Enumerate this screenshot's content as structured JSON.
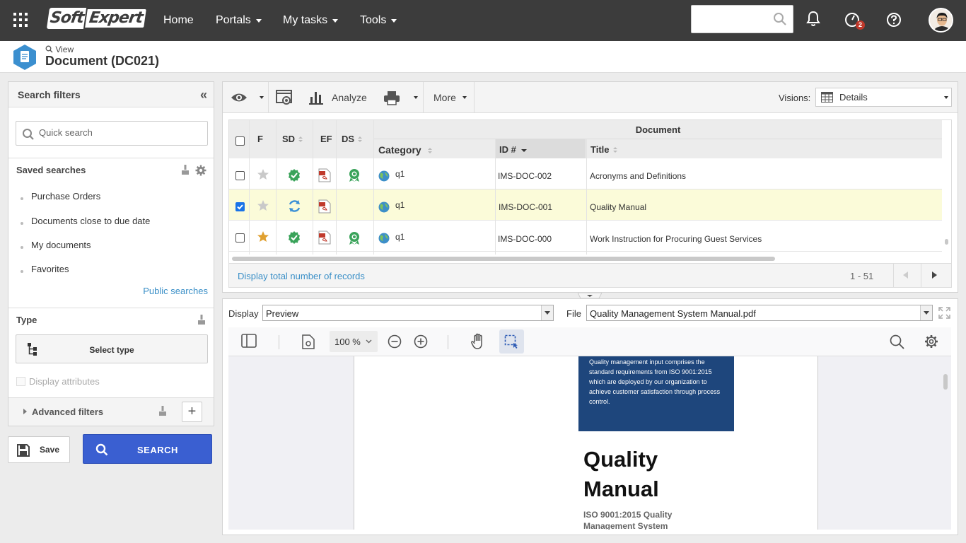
{
  "header": {
    "logo_left": "Soft",
    "logo_right": "Expert",
    "nav": [
      "Home",
      "Portals",
      "My tasks",
      "Tools"
    ],
    "notification_count": "2"
  },
  "titlebar": {
    "view_label": "View",
    "title": "Document (DC021)"
  },
  "left_panel": {
    "title": "Search filters",
    "collapse_glyph": "«",
    "quick_search_placeholder": "Quick search",
    "saved_searches_title": "Saved searches",
    "saved_searches": [
      "Purchase Orders",
      "Documents close to due date",
      "My documents",
      "Favorites"
    ],
    "public_searches": "Public searches",
    "type_title": "Type",
    "select_type": "Select type",
    "display_attributes": "Display attributes",
    "advanced_filters": "Advanced filters",
    "plus": "+",
    "save_label": "Save",
    "search_label": "SEARCH"
  },
  "toolbar": {
    "analyze": "Analyze",
    "more": "More",
    "visions_label": "Visions:",
    "visions_value": "Details"
  },
  "grid": {
    "columns": {
      "f": "F",
      "sd": "SD",
      "ef": "EF",
      "ds": "DS",
      "group": "Document",
      "category": "Category",
      "id": "ID #",
      "title": "Title"
    },
    "rows": [
      {
        "category": "q1",
        "id": "IMS-DOC-002",
        "title": "Acronyms and Definitions"
      },
      {
        "category": "q1",
        "id": "IMS-DOC-001",
        "title": "Quality Manual"
      },
      {
        "category": "q1",
        "id": "IMS-DOC-000",
        "title": "Work Instruction for Procuring Guest Services"
      }
    ],
    "footer_link": "Display total number of records",
    "pagination": "1 - 51"
  },
  "preview": {
    "display_label": "Display",
    "display_value": "Preview",
    "file_label": "File",
    "file_value": "Quality Management System Manual.pdf",
    "zoom": "100 %",
    "pdf_block_text": "Quality management input comprises the standard requirements from ISO 9001:2015 which are deployed by our organization to achieve customer satisfaction through process control.",
    "pdf_title_line1": "Quality",
    "pdf_title_line2": "Manual",
    "pdf_subtitle": "ISO 9001:2015 Quality Management System"
  },
  "colors": {
    "topbar": "#3c3c3c",
    "accent_blue": "#3a5fd1",
    "link_blue": "#3a8fc7",
    "selected_row": "#fbfbd9",
    "pdf_block": "#1e467c"
  }
}
